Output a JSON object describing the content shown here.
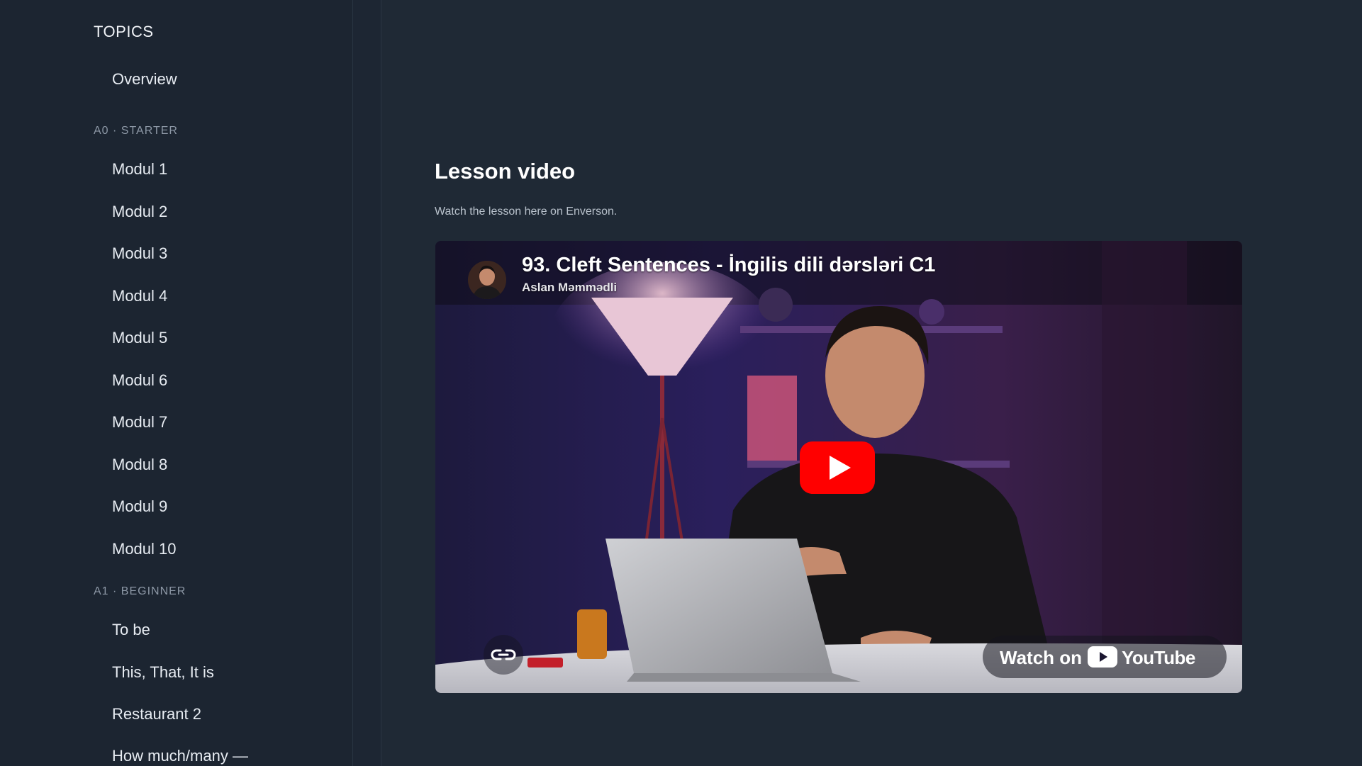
{
  "sidebar": {
    "title": "TOPICS",
    "overview": "Overview",
    "sections": [
      {
        "label": "A0 · STARTER",
        "items": [
          "Modul 1",
          "Modul 2",
          "Modul 3",
          "Modul 4",
          "Modul 5",
          "Modul 6",
          "Modul 7",
          "Modul 8",
          "Modul 9",
          "Modul 10"
        ]
      },
      {
        "label": "A1 · BEGINNER",
        "items": [
          "To be",
          "This, That, It is",
          "Restaurant 2",
          "How much/many —"
        ]
      }
    ]
  },
  "main": {
    "heading": "Lesson video",
    "subheading": "Watch the lesson here on Enverson.",
    "video": {
      "title": "93. Cleft Sentences - İngilis dili dərsləri C1",
      "channel": "Aslan Məmmədli",
      "watch_on": "Watch on",
      "platform": "YouTube",
      "play_icon": "play-icon",
      "link_icon": "link-icon"
    }
  },
  "colors": {
    "page_bg": "#1f2935",
    "sidebar_bg": "#1c2531",
    "youtube_red": "#ff0000"
  }
}
